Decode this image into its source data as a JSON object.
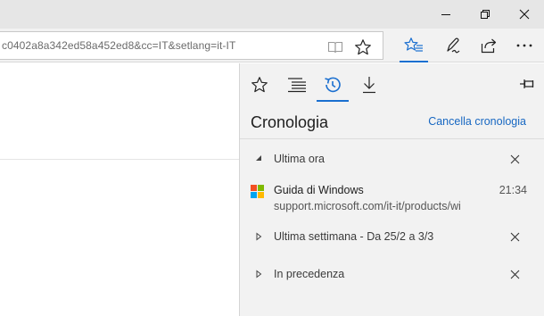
{
  "address_bar": {
    "url": "c0402a8a342ed58a452ed8&cc=IT&setlang=it-IT"
  },
  "hub": {
    "title": "Cronologia",
    "clear_label": "Cancella cronologia",
    "groups": [
      {
        "label": "Ultima ora",
        "expanded": true
      },
      {
        "label": "Ultima settimana - Da 25/2 a 3/3",
        "expanded": false
      },
      {
        "label": "In precedenza",
        "expanded": false
      }
    ],
    "entries": [
      {
        "title": "Guida di Windows",
        "url": "support.microsoft.com/it-it/products/wi",
        "time": "21:34",
        "favicon": "microsoft-logo"
      }
    ]
  },
  "colors": {
    "accent": "#1a6fd0",
    "link": "#1767c2",
    "titlebar": "#e6e6e6",
    "panel": "#f2f2f2"
  },
  "icons": {
    "window": [
      "minimize-icon",
      "maximize-icon",
      "close-icon"
    ],
    "address": [
      "reading-view-icon",
      "favorite-star-icon"
    ],
    "toolbar": [
      "hub-icon",
      "web-note-icon",
      "share-icon",
      "more-icon"
    ],
    "hub_tabs": [
      "favorites-icon",
      "reading-list-icon",
      "history-icon",
      "downloads-icon"
    ],
    "pin": "pin-icon"
  }
}
